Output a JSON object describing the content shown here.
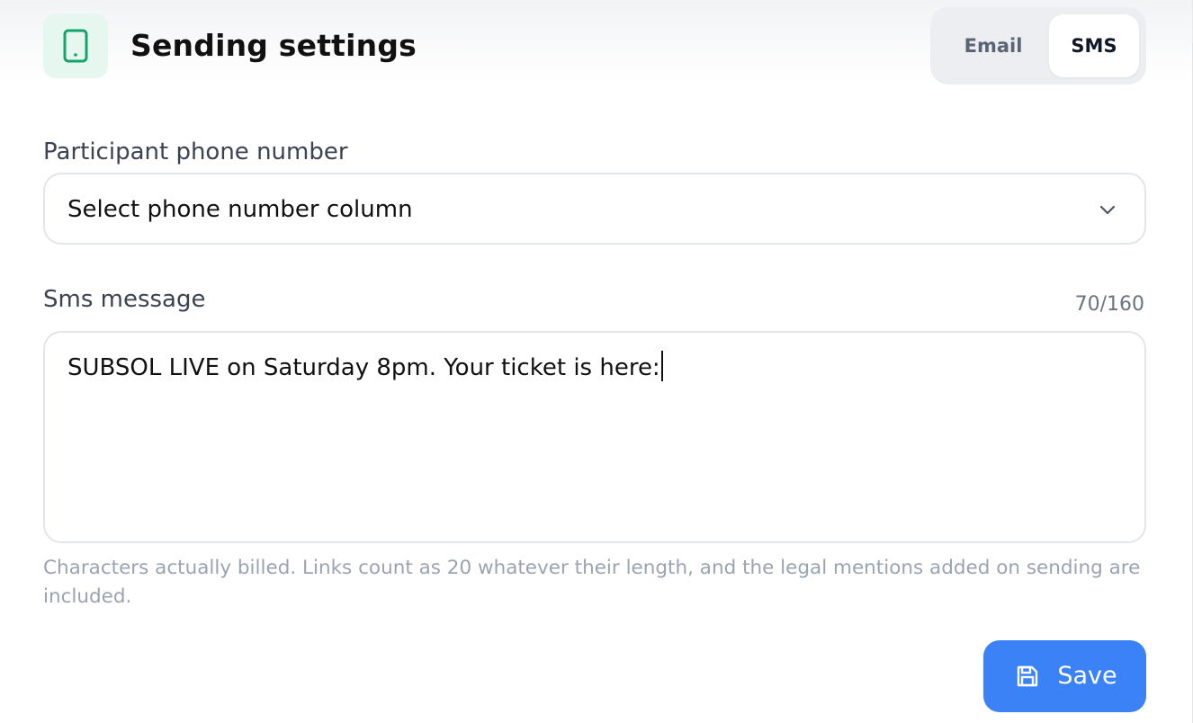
{
  "header": {
    "title": "Sending settings",
    "icon": "smartphone-icon",
    "icon_color": "#16a36a"
  },
  "channel_toggle": {
    "options": [
      {
        "label": "Email",
        "selected": false
      },
      {
        "label": "SMS",
        "selected": true
      }
    ]
  },
  "phone_field": {
    "label": "Participant phone number",
    "value": "Select phone number column",
    "icon": "chevron-down-icon"
  },
  "sms_field": {
    "label": "Sms message",
    "counter": "70/160",
    "value": "SUBSOL LIVE on Saturday 8pm. Your ticket is here:"
  },
  "help_text": "Characters actually billed. Links count as 20 whatever their length, and the legal mentions added on sending are included.",
  "save_button": {
    "label": "Save",
    "icon": "floppy-disk-icon",
    "color": "#3b82f6"
  }
}
